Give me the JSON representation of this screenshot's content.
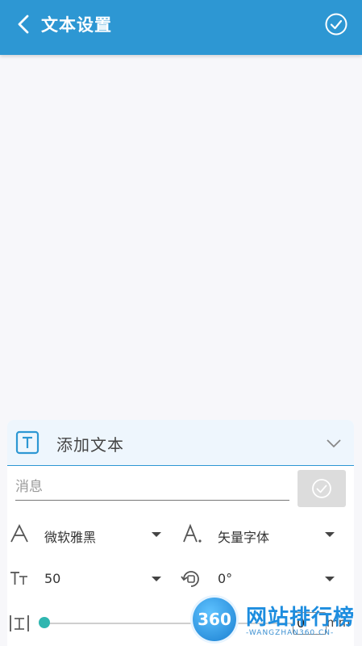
{
  "header": {
    "title": "文本设置"
  },
  "panel": {
    "title": "添加文本",
    "message_placeholder": "消息",
    "font_name": "微软雅黑",
    "font_type": "矢量字体",
    "font_size": "50",
    "rotation": "0°",
    "spacing_value": "0",
    "spacing_unit": "mm"
  },
  "watermark": {
    "badge": "360",
    "title": "网站排行榜",
    "subtitle": "-WANGZHAN360.CN-"
  },
  "colors": {
    "primary": "#2d97d3",
    "slider": "#2fb6b0",
    "background": "#f7f7fa"
  }
}
